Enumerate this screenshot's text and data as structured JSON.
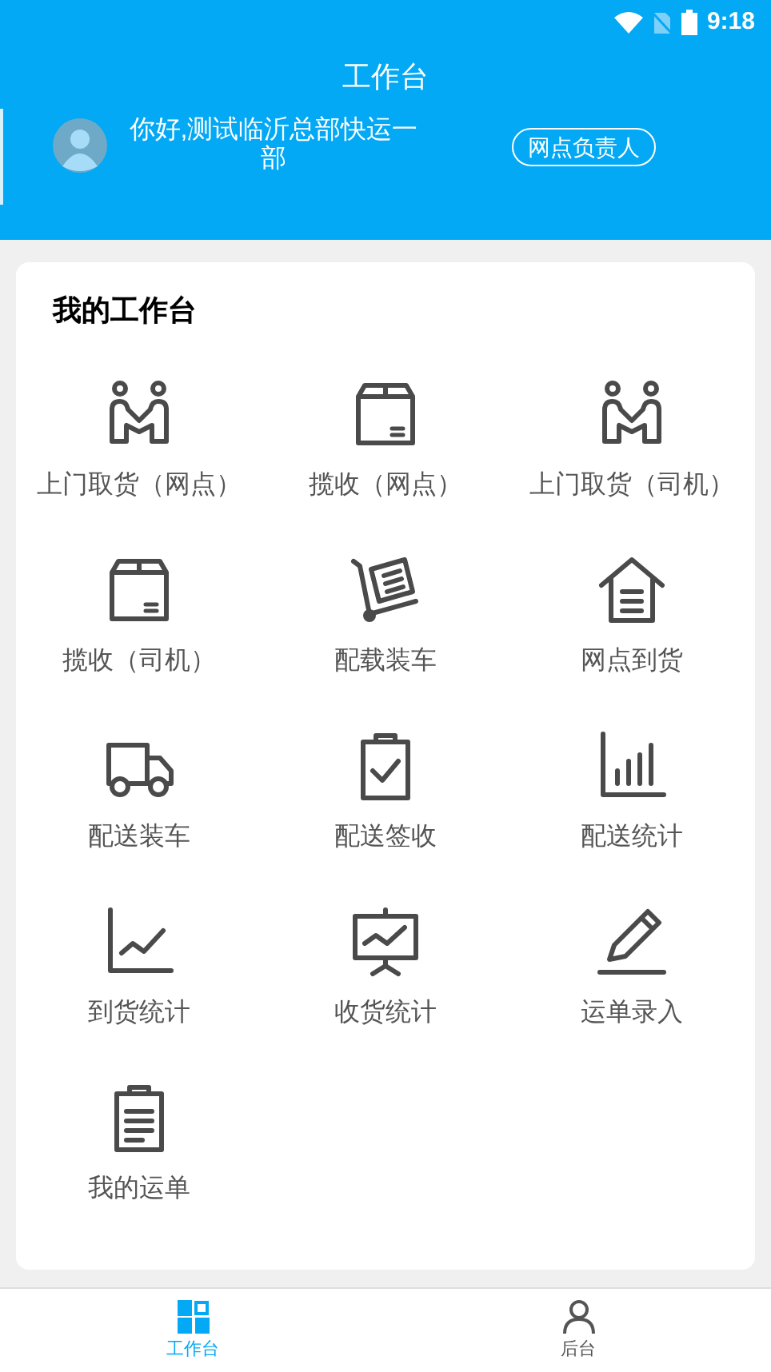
{
  "status_bar": {
    "time": "9:18"
  },
  "header": {
    "title": "工作台",
    "greeting": "你好,测试临沂总部快运一部",
    "role": "网点负责人"
  },
  "workbench": {
    "title": "我的工作台",
    "items": [
      {
        "label": "上门取货（网点）"
      },
      {
        "label": "揽收（网点）"
      },
      {
        "label": "上门取货（司机）"
      },
      {
        "label": "揽收（司机）"
      },
      {
        "label": "配载装车"
      },
      {
        "label": "网点到货"
      },
      {
        "label": "配送装车"
      },
      {
        "label": "配送签收"
      },
      {
        "label": "配送统计"
      },
      {
        "label": "到货统计"
      },
      {
        "label": "收货统计"
      },
      {
        "label": "运单录入"
      },
      {
        "label": "我的运单"
      }
    ]
  },
  "bottom_nav": [
    {
      "label": "工作台",
      "selected": true
    },
    {
      "label": "后台",
      "selected": false
    }
  ]
}
